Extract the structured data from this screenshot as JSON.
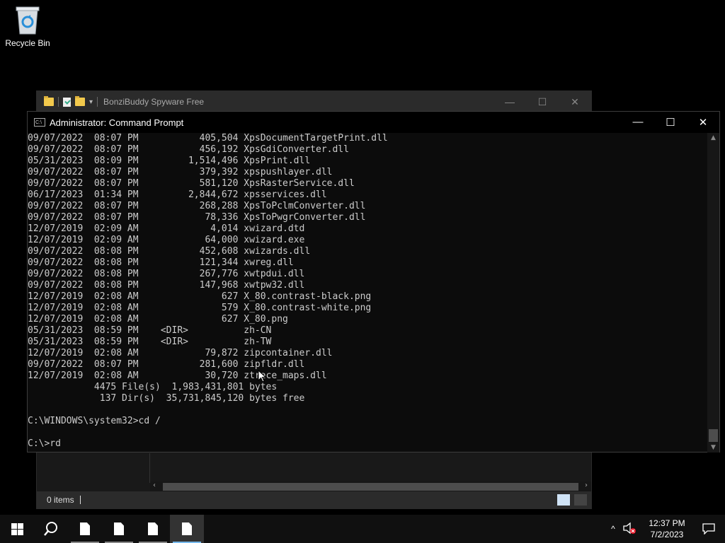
{
  "desktop": {
    "icons": [
      {
        "label": "Recycle Bin",
        "icon": "recycle-bin-icon"
      }
    ]
  },
  "explorer": {
    "title": "BonziBuddy Spyware Free",
    "status_items": "0 items",
    "controls": {
      "minimize": "—",
      "maximize": "☐",
      "close": "✕"
    }
  },
  "cmd": {
    "title": "Administrator: Command Prompt",
    "controls": {
      "minimize": "—",
      "maximize": "☐",
      "close": "✕"
    },
    "lines": [
      "09/07/2022  08:07 PM           405,504 XpsDocumentTargetPrint.dll",
      "09/07/2022  08:07 PM           456,192 XpsGdiConverter.dll",
      "05/31/2023  08:09 PM         1,514,496 XpsPrint.dll",
      "09/07/2022  08:07 PM           379,392 xpspushlayer.dll",
      "09/07/2022  08:07 PM           581,120 XpsRasterService.dll",
      "06/17/2023  01:34 PM         2,844,672 xpsservices.dll",
      "09/07/2022  08:07 PM           268,288 XpsToPclmConverter.dll",
      "09/07/2022  08:07 PM            78,336 XpsToPwgrConverter.dll",
      "12/07/2019  02:09 AM             4,014 xwizard.dtd",
      "12/07/2019  02:09 AM            64,000 xwizard.exe",
      "09/07/2022  08:08 PM           452,608 xwizards.dll",
      "09/07/2022  08:08 PM           121,344 xwreg.dll",
      "09/07/2022  08:08 PM           267,776 xwtpdui.dll",
      "09/07/2022  08:08 PM           147,968 xwtpw32.dll",
      "12/07/2019  02:08 AM               627 X_80.contrast-black.png",
      "12/07/2019  02:08 AM               579 X_80.contrast-white.png",
      "12/07/2019  02:08 AM               627 X_80.png",
      "05/31/2023  08:59 PM    <DIR>          zh-CN",
      "05/31/2023  08:59 PM    <DIR>          zh-TW",
      "12/07/2019  02:08 AM            79,872 zipcontainer.dll",
      "09/07/2022  08:07 PM           281,600 zipfldr.dll",
      "12/07/2019  02:08 AM            30,720 ztrace_maps.dll",
      "            4475 File(s)  1,983,431,801 bytes",
      "             137 Dir(s)  35,731,845,120 bytes free",
      "",
      "C:\\WINDOWS\\system32>cd /",
      "",
      "C:\\>rd"
    ]
  },
  "taskbar": {
    "start_icon": "windows-logo-icon",
    "search_icon": "search-icon",
    "apps": [
      {
        "icon": "file-icon",
        "active": false
      },
      {
        "icon": "file-icon",
        "active": false
      },
      {
        "icon": "file-icon",
        "active": false
      },
      {
        "icon": "file-icon",
        "active": true
      }
    ],
    "tray": {
      "chevron": "^",
      "time": "12:37 PM",
      "date": "7/2/2023"
    }
  }
}
